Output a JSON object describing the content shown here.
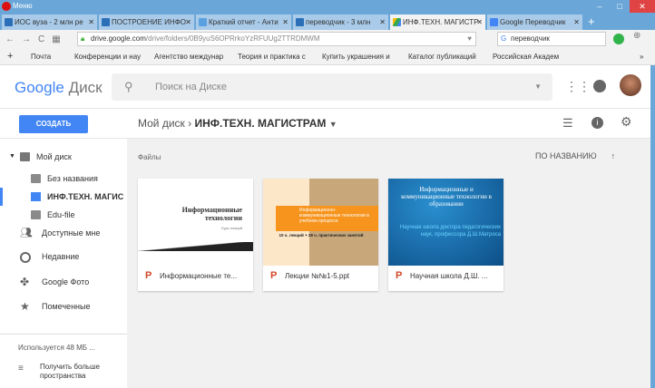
{
  "window": {
    "title": "Меню"
  },
  "tabs": [
    {
      "label": "ИОС вуза - 2 млн ре"
    },
    {
      "label": "ПОСТРОЕНИЕ ИНФО"
    },
    {
      "label": "Краткий отчет - Анти"
    },
    {
      "label": "переводчик - 3 млн"
    },
    {
      "label": "ИНФ.ТЕХН. МАГИСТР",
      "active": true
    },
    {
      "label": "Google Переводчик"
    }
  ],
  "address": {
    "domain": "drive.google.com",
    "path": "/drive/folders/0B9yuS6OPRrkoYzRFUUg2TTRDMWM",
    "search": "переводчик"
  },
  "bookmarks": [
    "Почта",
    "Конференции и нау",
    "Агентство междунар",
    "Теория и практика с",
    "Купить украшения и",
    "Каталог публикаций",
    "Российская Академ"
  ],
  "drive": {
    "logo": "Google",
    "product": "Диск",
    "search_placeholder": "Поиск на Диске",
    "create": "СОЗДАТЬ",
    "breadcrumb_root": "Мой диск",
    "breadcrumb_current": "ИНФ.ТЕХН. МАГИСТРАМ",
    "sort": "ПО НАЗВАНИЮ",
    "files_label": "Файлы"
  },
  "sidebar": {
    "items": [
      "Мой диск",
      "Без названия",
      "ИНФ.ТЕХН. МАГИС",
      "Edu-file",
      "Доступные мне",
      "Недавние",
      "Google Фото",
      "Помеченные"
    ],
    "storage": "Используется 48 МБ ...",
    "upgrade1": "Получить больше",
    "upgrade2": "пространства"
  },
  "files": [
    {
      "name": "Информационные те...",
      "thumb_title": "Информационные технологии",
      "thumb_sub": "Курс лекций"
    },
    {
      "name": "Лекции №№1-5.ppt",
      "thumb_title": "Информационно-коммуникационные технологии в учебном процессе",
      "thumb_sub": "10 ч. лекций + 28 ч. практических занятий"
    },
    {
      "name": "Научная школа Д.Ш. ...",
      "thumb_title": "Информационные и коммуникационные технологии в образовании",
      "thumb_sub": "Научная школа доктора педагогических наук, профессора Д.Ш.Матроса"
    }
  ]
}
